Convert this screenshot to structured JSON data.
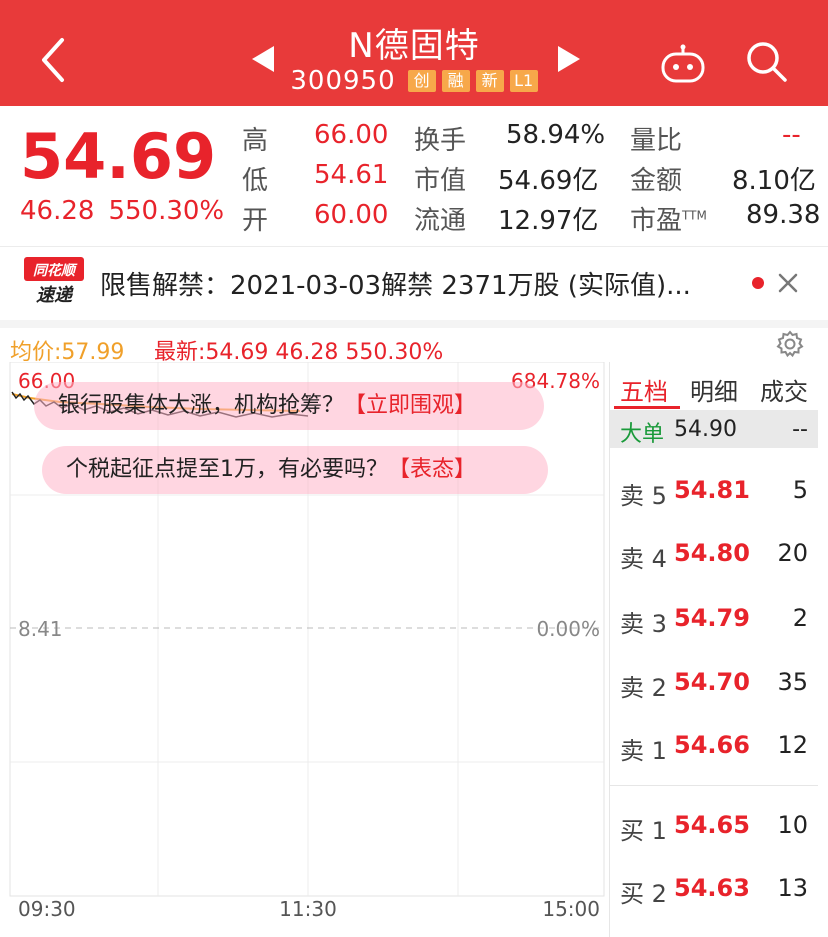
{
  "header": {
    "title": "N德固特",
    "code": "300950",
    "tags": [
      "创",
      "融",
      "新",
      "L1"
    ]
  },
  "quote": {
    "price": "54.69",
    "change": "46.28",
    "change_pct": "550.30%",
    "stats": [
      {
        "label": "高",
        "value": "66.00"
      },
      {
        "label": "低",
        "value": "54.61"
      },
      {
        "label": "开",
        "value": "60.00"
      },
      {
        "label": "换手",
        "value": "58.94%"
      },
      {
        "label": "市值",
        "value": "54.69亿"
      },
      {
        "label": "流通",
        "value": "12.97亿"
      },
      {
        "label": "量比",
        "value": "--"
      },
      {
        "label": "金额",
        "value": "8.10亿"
      },
      {
        "label": "市盈",
        "value": "89.38",
        "sup": "TTM"
      }
    ]
  },
  "news": {
    "logo_top": "同花顺",
    "logo_bottom": "速递",
    "text": "限售解禁：2021-03-03解禁 2371万股 (实际值)..."
  },
  "chart_stats": {
    "avg": "均价:57.99",
    "latest": "最新:54.69  46.28  550.30%"
  },
  "chart": {
    "y_top_left": "66.00",
    "y_top_right": "684.78%",
    "y_mid_left": "8.41",
    "y_mid_right": "0.00%",
    "x_labels": [
      "09:30",
      "11:30",
      "15:00"
    ],
    "pills": [
      {
        "text": "银行股集体大涨，机构抢筹？",
        "link": "【立即围观】"
      },
      {
        "text": "个税起征点提至1万，有必要吗？",
        "link": "【表态】"
      }
    ],
    "colors": {
      "price_line": "#222222",
      "avg_line": "#f0a02a",
      "accent": "#e8232b"
    }
  },
  "orderbook": {
    "tabs": [
      "五档",
      "明细",
      "成交"
    ],
    "big_order": {
      "label": "大单",
      "price": "54.90",
      "vol": "--"
    },
    "sells": [
      {
        "label": "卖 5",
        "price": "54.81",
        "vol": "5"
      },
      {
        "label": "卖 4",
        "price": "54.80",
        "vol": "20"
      },
      {
        "label": "卖 3",
        "price": "54.79",
        "vol": "2"
      },
      {
        "label": "卖 2",
        "price": "54.70",
        "vol": "35"
      },
      {
        "label": "卖 1",
        "price": "54.66",
        "vol": "12"
      }
    ],
    "buys": [
      {
        "label": "买 1",
        "price": "54.65",
        "vol": "10"
      },
      {
        "label": "买 2",
        "price": "54.63",
        "vol": "13"
      }
    ]
  }
}
